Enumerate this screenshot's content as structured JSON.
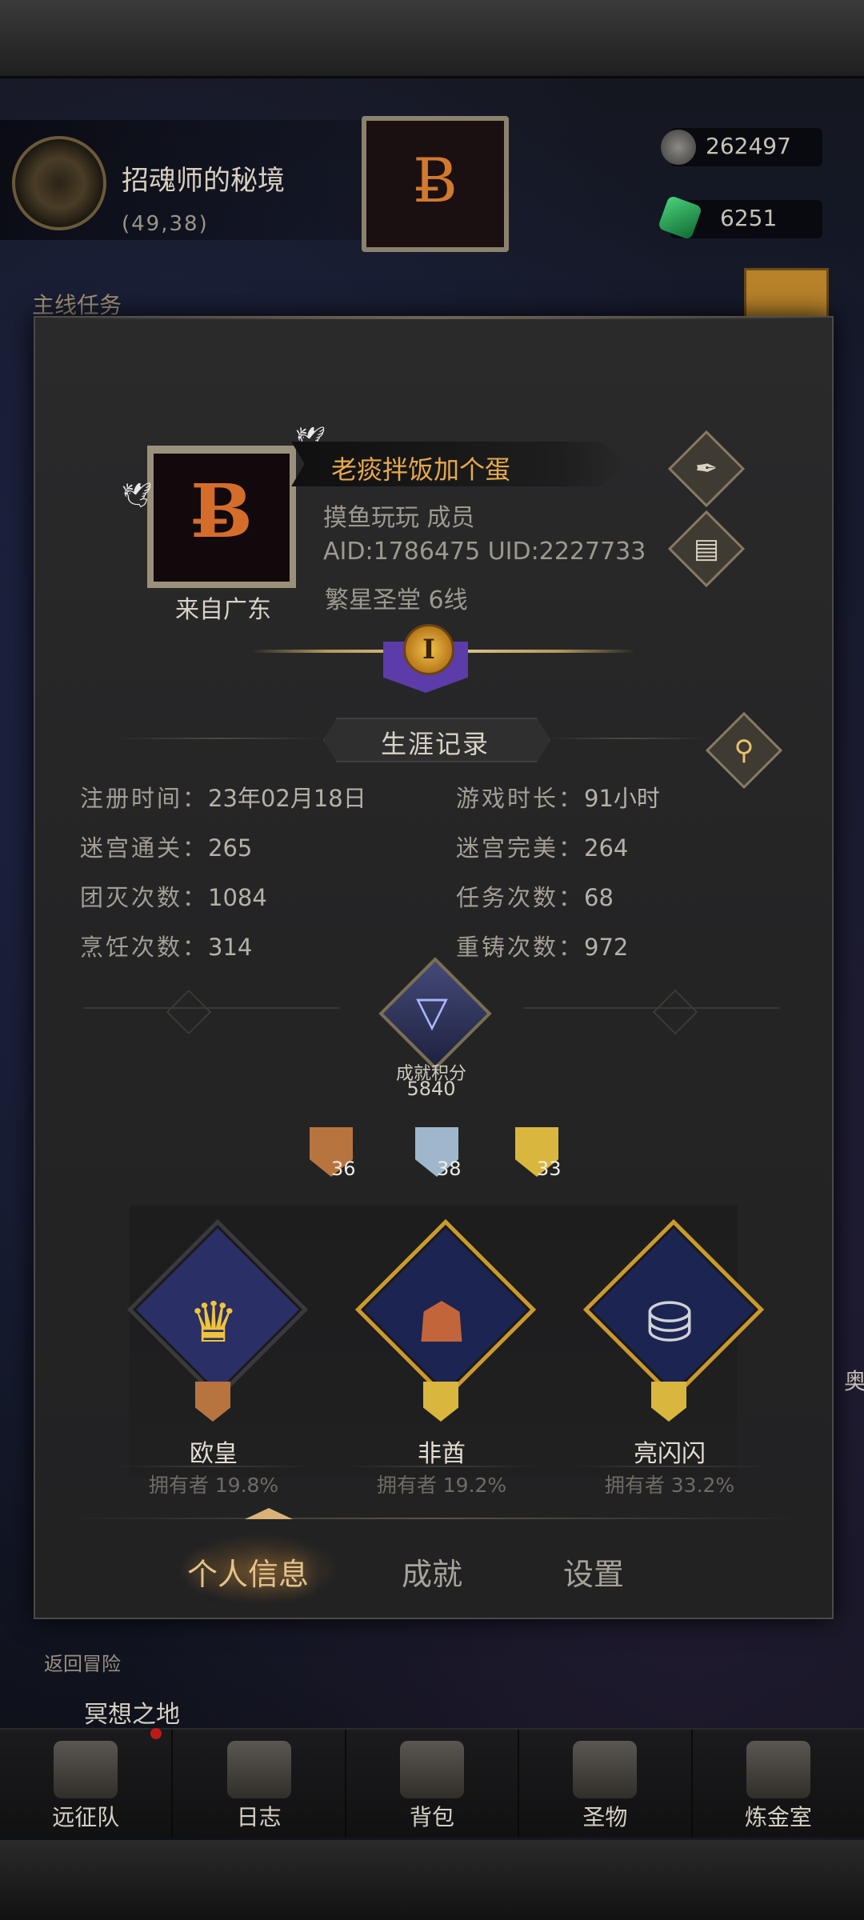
{
  "background": {
    "location_title": "招魂师的秘境",
    "location_coords": "(49,38)",
    "resource_1": "262497",
    "resource_2": "6251",
    "side_label": "主线任务",
    "return_label": "返回冒险",
    "meditate_label": "冥想之地",
    "right_edge_label": "奥"
  },
  "profile": {
    "player_name": "老痰拌饭加个蛋",
    "guild_line": "摸鱼玩玩 成员",
    "ids_line": "AID:1786475  UID:2227733",
    "server_line": "繁星圣堂 6线",
    "origin": "来自广东",
    "rank_numeral": "I"
  },
  "career": {
    "title": "生涯记录",
    "stats": [
      {
        "label": "注册时间：",
        "value": "23年02月18日"
      },
      {
        "label": "游戏时长：",
        "value": "91小时"
      },
      {
        "label": "迷宫通关：",
        "value": "265"
      },
      {
        "label": "迷宫完美：",
        "value": "264"
      },
      {
        "label": "团灭次数：",
        "value": "1084"
      },
      {
        "label": "任务次数：",
        "value": "68"
      },
      {
        "label": "烹饪次数：",
        "value": "314"
      },
      {
        "label": "重铸次数：",
        "value": "972"
      }
    ]
  },
  "achievements": {
    "score_label": "成就积分",
    "score_value": "5840",
    "tiers": [
      {
        "name": "bronze",
        "count": "36",
        "color": "#b8743f"
      },
      {
        "name": "silver",
        "count": "38",
        "color": "#9fb6cc"
      },
      {
        "name": "gold",
        "count": "33",
        "color": "#d9b63d"
      }
    ],
    "featured": [
      {
        "name": "欧皇",
        "owner": "拥有者 19.8%",
        "icon": "crown-icon",
        "border": "#3a3a3c",
        "bg": "#2a2f66"
      },
      {
        "name": "非酋",
        "owner": "拥有者 19.2%",
        "icon": "tribal-chief-icon",
        "border": "#cb9a2c",
        "bg": "#1c2452"
      },
      {
        "name": "亮闪闪",
        "owner": "拥有者 33.2%",
        "icon": "silver-coins-icon",
        "border": "#cb9a2c",
        "bg": "#1c2452"
      }
    ]
  },
  "tabs": [
    {
      "label": "个人信息",
      "active": true
    },
    {
      "label": "成就",
      "active": false
    },
    {
      "label": "设置",
      "active": false
    }
  ],
  "bottom_nav": [
    {
      "label": "远征队",
      "icon": "viking-helmet-icon"
    },
    {
      "label": "日志",
      "icon": "scroll-icon"
    },
    {
      "label": "背包",
      "icon": "backpack-icon"
    },
    {
      "label": "圣物",
      "icon": "chalice-icon"
    },
    {
      "label": "炼金室",
      "icon": "alchemy-icon"
    }
  ]
}
